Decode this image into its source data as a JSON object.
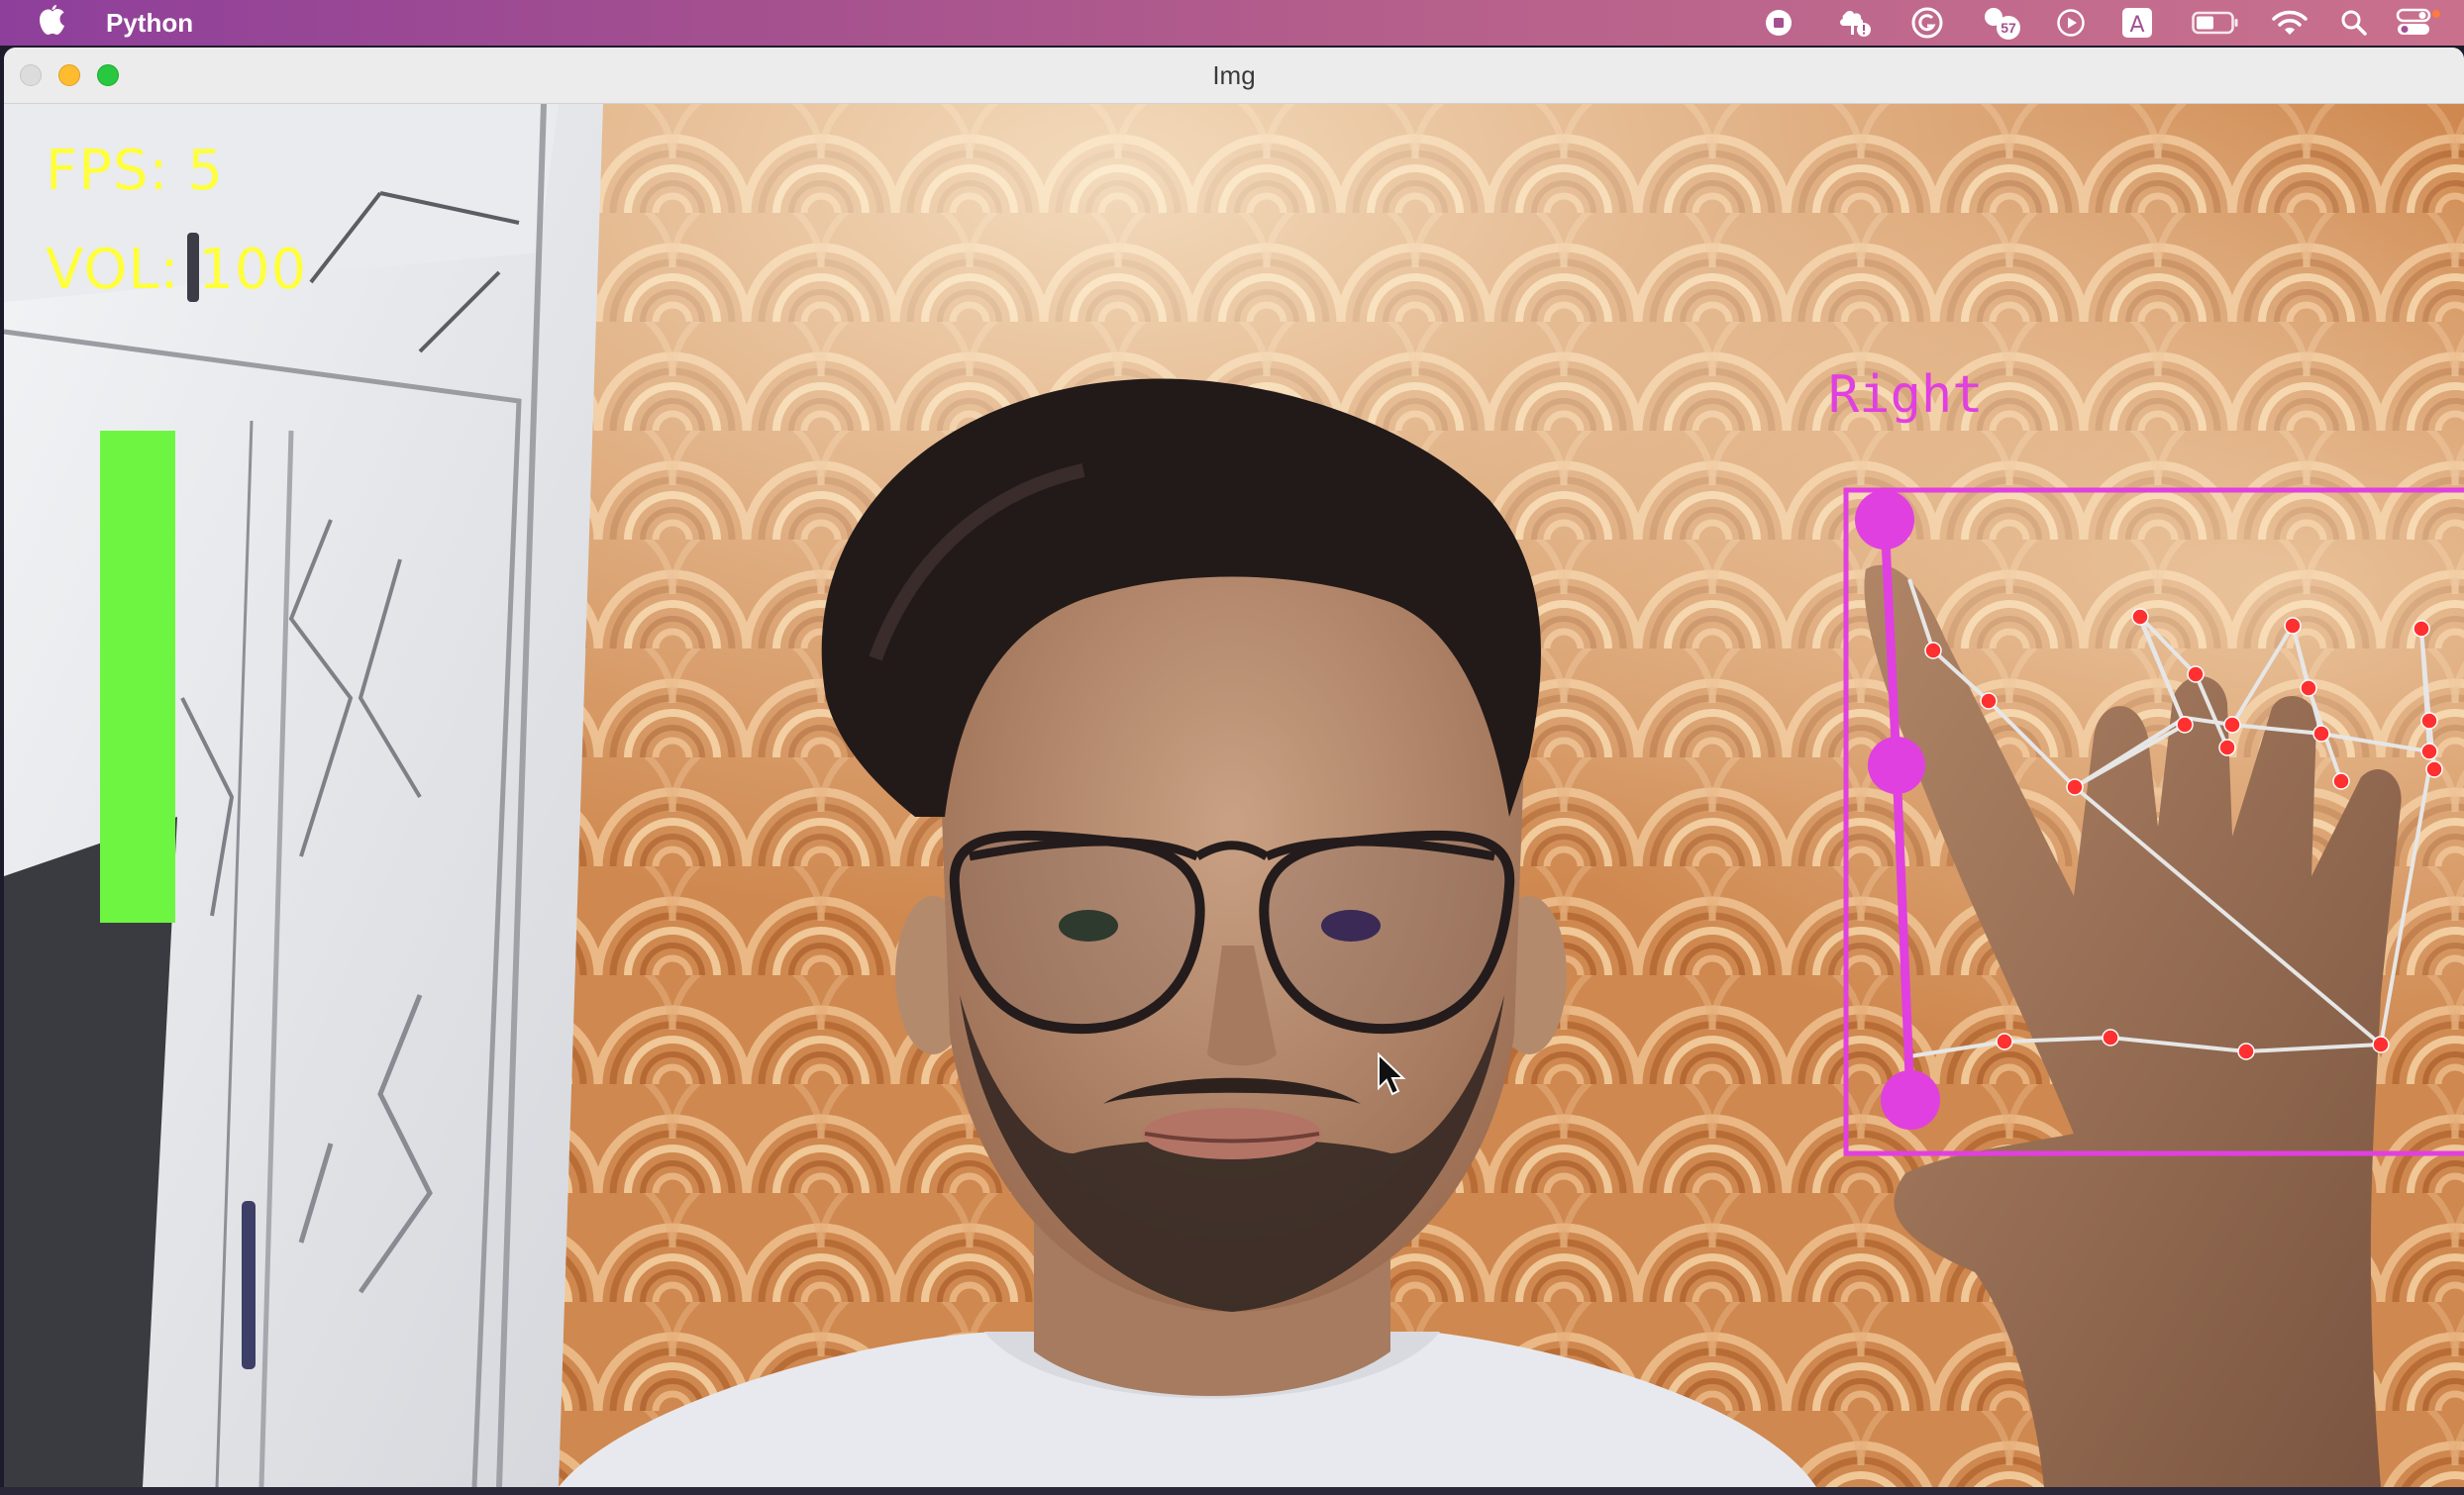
{
  "menubar": {
    "app_name": "Python",
    "icons": [
      "apple-icon",
      "record-stop-icon",
      "tree-status-icon",
      "grammarly-icon",
      "notification-badge-icon",
      "play-circle-icon",
      "text-input-icon",
      "battery-icon",
      "wifi-icon",
      "spotlight-search-icon",
      "control-center-icon"
    ],
    "badge_count": "57",
    "input_letter": "A"
  },
  "window": {
    "title": "Img"
  },
  "overlay": {
    "fps_text": "FPS: 5",
    "vol_text": "VOL: 100",
    "hand_label": "Right",
    "volume_percent": 100,
    "bar_color": "#6ef542",
    "hud_color": "#ffff3c",
    "landmark_color": "#e040e0",
    "point_color": "#ff3030"
  }
}
